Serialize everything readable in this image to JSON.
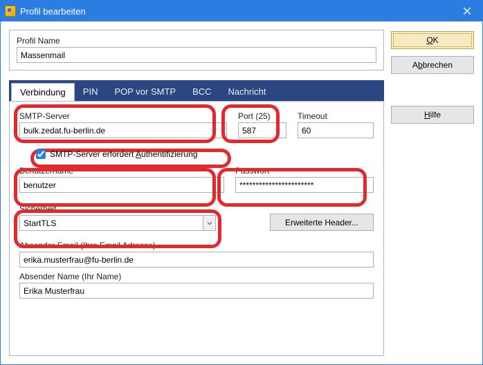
{
  "window": {
    "title": "Profil bearbeiten"
  },
  "profile": {
    "name_label": "Profil Name",
    "name_value": "Massenmail"
  },
  "tabs": {
    "verbindung": "Verbindung",
    "pin": "PIN",
    "popvorsmtp": "POP vor SMTP",
    "bcc": "BCC",
    "nachricht": "Nachricht"
  },
  "conn": {
    "smtp_label": "SMTP-Server",
    "smtp_value": "bulk.zedat.fu-berlin.de",
    "port_label": "Port (25)",
    "port_value": "587",
    "timeout_label": "Timeout",
    "timeout_value": "60",
    "auth_label_pre": "SMTP-Server erfordert ",
    "auth_label_mn": "A",
    "auth_label_post": "uthentifizierung",
    "user_label": "Benutzername",
    "user_value": "benutzer",
    "pass_label": "Passwort",
    "pass_value": "***********************",
    "security_label": "Sicherheit",
    "security_value": "StartTLS",
    "extheader_label": "Erweiterte Header...",
    "sender_email_label": "Absender Email  (Ihre Email Adresse)",
    "sender_email_value": "erika.musterfrau@fu-berlin.de",
    "sender_name_label": "Absender Name  (Ihr Name)",
    "sender_name_value": "Erika Musterfrau"
  },
  "buttons": {
    "ok_mn": "O",
    "ok_post": "K",
    "cancel_pre": "A",
    "cancel_mn": "b",
    "cancel_post": "brechen",
    "help_mn": "H",
    "help_post": "ilfe"
  }
}
